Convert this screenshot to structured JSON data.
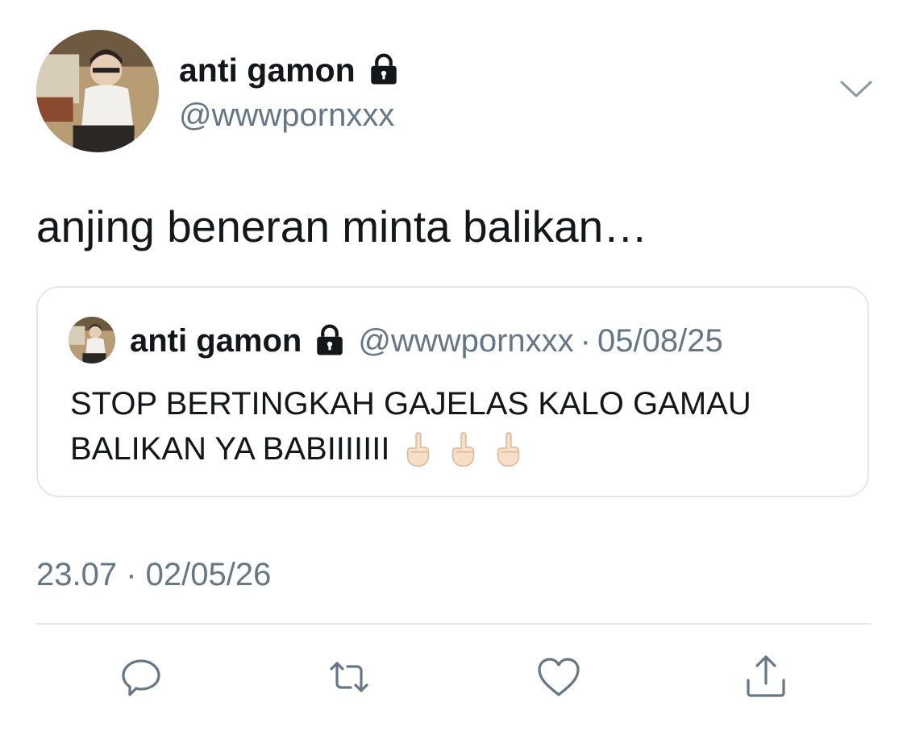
{
  "author": {
    "display_name": "anti gamon",
    "handle": "@wwwpornxxx",
    "protected_icon": "lock-icon"
  },
  "tweet": {
    "text": "anjing beneran minta balikan…",
    "timestamp": "23.07 · 02/05/26"
  },
  "quoted_tweet": {
    "display_name": "anti gamon",
    "handle": "@wwwpornxxx",
    "separator": "·",
    "date": "05/08/25",
    "text": "STOP BERTINGKAH GAJELAS KALO GAMAU BALIKAN YA BABIIIIIII",
    "emoji_icons": [
      "middle-finger-icon",
      "middle-finger-icon",
      "middle-finger-icon"
    ]
  },
  "actions": [
    "reply-icon",
    "retweet-icon",
    "like-icon",
    "share-icon"
  ],
  "colors": {
    "text": "#14171a",
    "secondary": "#657786",
    "border": "#e1e8ed"
  }
}
